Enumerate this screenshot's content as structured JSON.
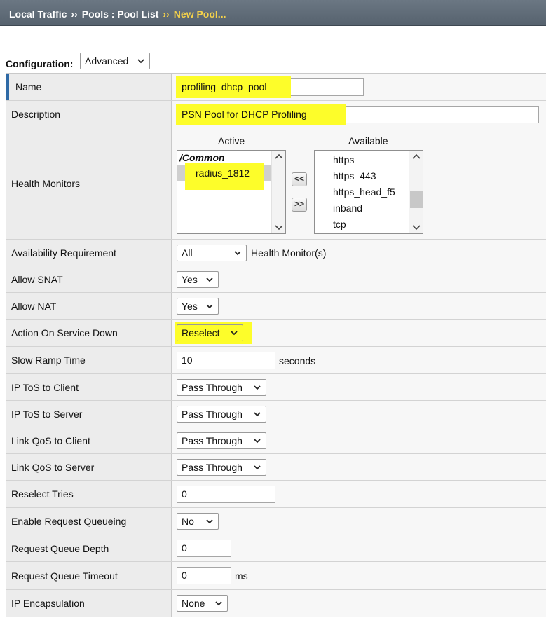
{
  "breadcrumb": {
    "items": [
      "Local Traffic",
      "Pools : Pool List"
    ],
    "separator": "››",
    "current": "New Pool..."
  },
  "configuration": {
    "label": "Configuration:",
    "value": "Advanced"
  },
  "fields": {
    "name": {
      "label": "Name",
      "value": "profiling_dhcp_pool"
    },
    "description": {
      "label": "Description",
      "value": "PSN Pool for DHCP Profiling"
    },
    "health_monitors": {
      "label": "Health Monitors",
      "active_header": "Active",
      "available_header": "Available",
      "active_group": "/Common",
      "active_items": [
        "radius_1812"
      ],
      "available_items": [
        "https",
        "https_443",
        "https_head_f5",
        "inband",
        "tcp"
      ],
      "add_button": "<<",
      "remove_button": ">>"
    },
    "availability_requirement": {
      "label": "Availability Requirement",
      "value": "All",
      "suffix": "Health Monitor(s)"
    },
    "allow_snat": {
      "label": "Allow SNAT",
      "value": "Yes"
    },
    "allow_nat": {
      "label": "Allow NAT",
      "value": "Yes"
    },
    "action_on_service_down": {
      "label": "Action On Service Down",
      "value": "Reselect"
    },
    "slow_ramp_time": {
      "label": "Slow Ramp Time",
      "value": "10",
      "suffix": "seconds"
    },
    "ip_tos_client": {
      "label": "IP ToS to Client",
      "value": "Pass Through"
    },
    "ip_tos_server": {
      "label": "IP ToS to Server",
      "value": "Pass Through"
    },
    "link_qos_client": {
      "label": "Link QoS to Client",
      "value": "Pass Through"
    },
    "link_qos_server": {
      "label": "Link QoS to Server",
      "value": "Pass Through"
    },
    "reselect_tries": {
      "label": "Reselect Tries",
      "value": "0"
    },
    "enable_request_queueing": {
      "label": "Enable Request Queueing",
      "value": "No"
    },
    "request_queue_depth": {
      "label": "Request Queue Depth",
      "value": "0"
    },
    "request_queue_timeout": {
      "label": "Request Queue Timeout",
      "value": "0",
      "suffix": "ms"
    },
    "ip_encapsulation": {
      "label": "IP Encapsulation",
      "value": "None"
    }
  },
  "colors": {
    "header_bg": "#5f6b77",
    "breadcrumb_current": "#f5d24a",
    "highlight": "#fdfd2a",
    "label_bg": "#ececec",
    "value_bg": "#f7f7f7",
    "accent_bar": "#2f6aa6"
  }
}
